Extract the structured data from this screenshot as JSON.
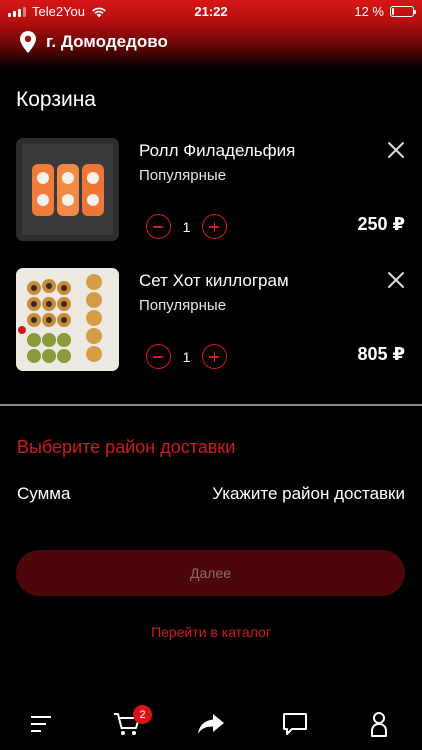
{
  "status_bar": {
    "carrier": "Tele2You",
    "time": "21:22",
    "battery_text": "12 %",
    "battery_level": 0.12
  },
  "header": {
    "city": "г. Домодедово",
    "icon": "location-pin-icon"
  },
  "cart": {
    "title": "Корзина",
    "items": [
      {
        "name": "Ролл Филадельфия",
        "category": "Популярные",
        "quantity": "1",
        "price": "250 ₽"
      },
      {
        "name": "Сет Хот киллограм",
        "category": "Популярные",
        "quantity": "1",
        "price": "805 ₽"
      }
    ]
  },
  "delivery": {
    "select_district": "Выберите район доставки",
    "sum_label": "Сумма",
    "sum_value": "Укажите район доставки"
  },
  "actions": {
    "next_label": "Далее",
    "catalog_link": "Перейти в каталог"
  },
  "tab_bar": {
    "cart_badge": "2",
    "icons": [
      "menu-icon",
      "cart-icon",
      "share-icon",
      "chat-icon",
      "profile-icon"
    ]
  },
  "colors": {
    "accent": "#d51b1b",
    "header_top": "#d61616",
    "background": "#000000",
    "disabled_button": "#4d0609"
  }
}
